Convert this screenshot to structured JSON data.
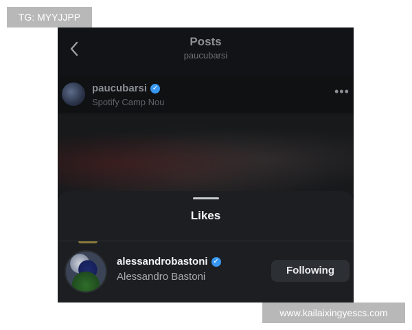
{
  "watermark_top": "TG: MYYJJPP",
  "watermark_bottom": "www.kailaixingyescs.com",
  "header": {
    "title": "Posts",
    "subtitle": "paucubarsi",
    "back_icon": "chevron-left-icon"
  },
  "post": {
    "username": "paucubarsi",
    "verified": true,
    "location": "Spotify Camp Nou",
    "more_icon": "more-horizontal-icon",
    "more_glyph": "•••"
  },
  "likes_sheet": {
    "title": "Likes",
    "items": [
      {
        "username": "alessandrobastoni",
        "verified": true,
        "full_name": "Alessandro Bastoni",
        "button_label": "Following"
      }
    ]
  },
  "colors": {
    "verified_badge": "#3897f0",
    "background": "#0f1113",
    "sheet": "#1c1e21"
  }
}
